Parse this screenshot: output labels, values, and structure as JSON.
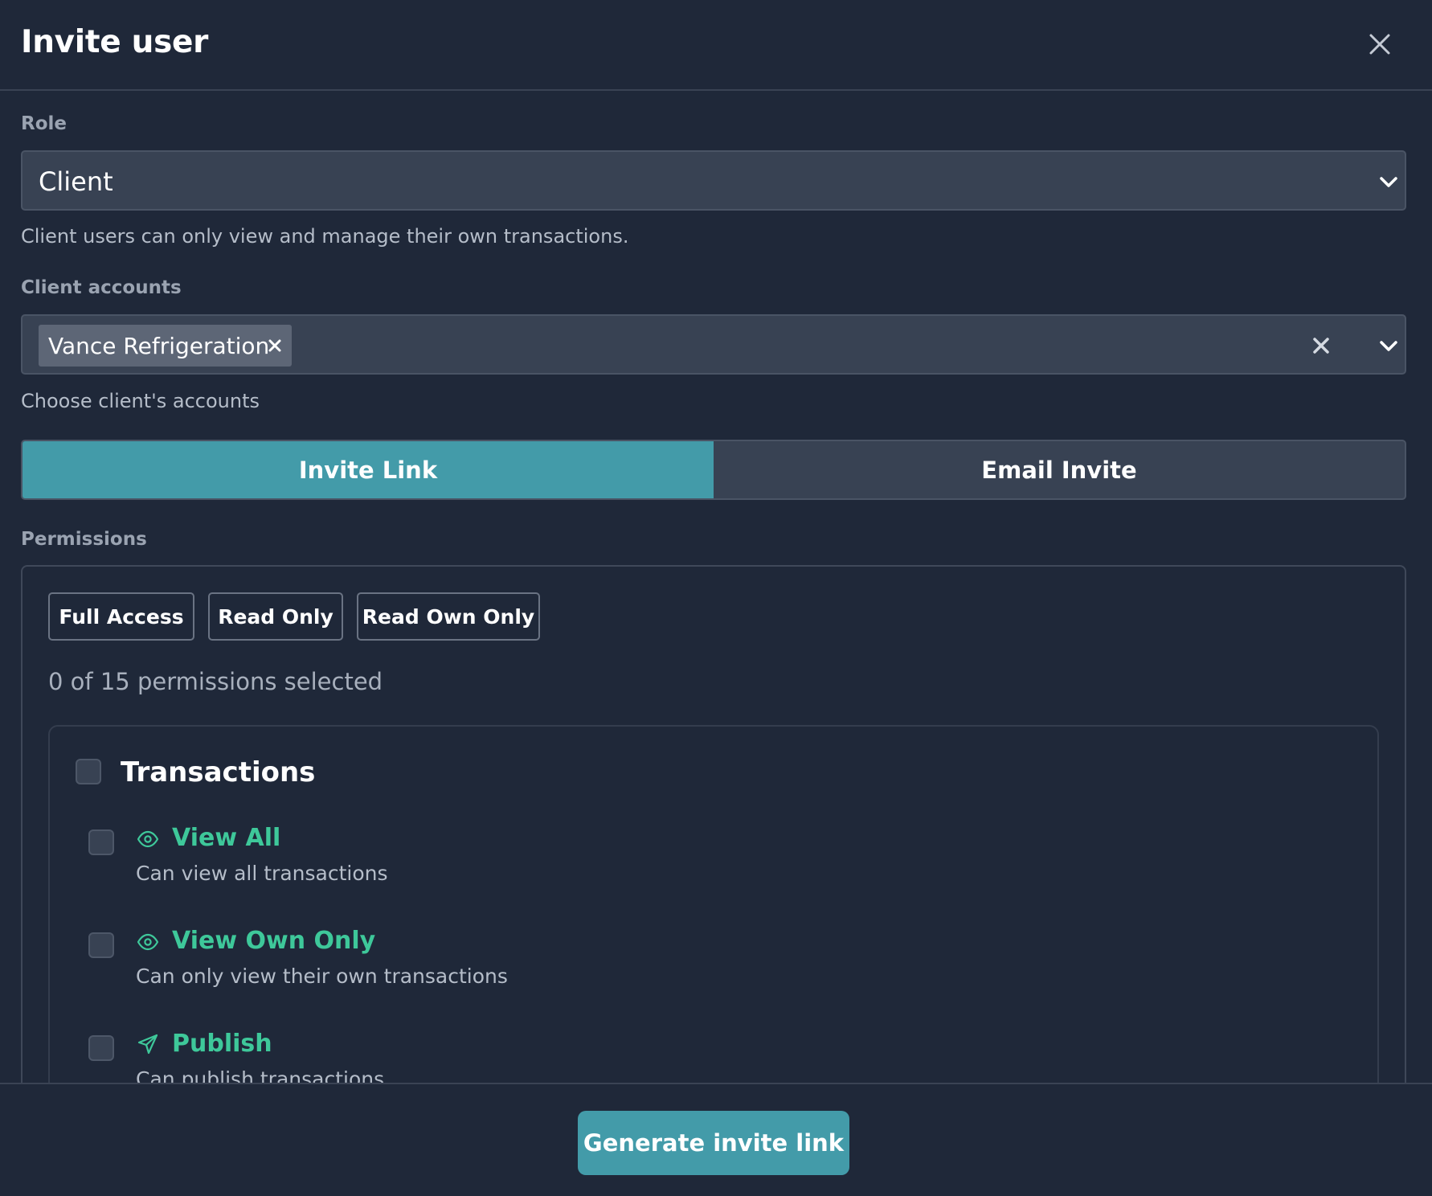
{
  "dialog": {
    "title": "Invite user"
  },
  "role": {
    "label": "Role",
    "value": "Client",
    "help": "Client users can only view and manage their own transactions."
  },
  "client_accounts": {
    "label": "Client accounts",
    "selected": [
      "Vance Refrigeration"
    ],
    "help": "Choose client's accounts"
  },
  "invite_tabs": [
    {
      "label": "Invite Link",
      "active": true
    },
    {
      "label": "Email Invite",
      "active": false
    }
  ],
  "permissions": {
    "label": "Permissions",
    "presets": [
      "Full Access",
      "Read Only",
      "Read Own Only"
    ],
    "count_text": "0 of 15 permissions selected",
    "groups": [
      {
        "title": "Transactions",
        "items": [
          {
            "name": "View All",
            "description": "Can view all transactions",
            "icon": "eye-icon"
          },
          {
            "name": "View Own Only",
            "description": "Can only view their own transactions",
            "icon": "eye-icon"
          },
          {
            "name": "Publish",
            "description": "Can publish transactions",
            "icon": "send-icon"
          }
        ]
      }
    ]
  },
  "footer": {
    "primary_label": "Generate invite link"
  },
  "colors": {
    "background": "#1f2839",
    "accent": "#439ba9",
    "permission_green": "#3ec89a"
  }
}
